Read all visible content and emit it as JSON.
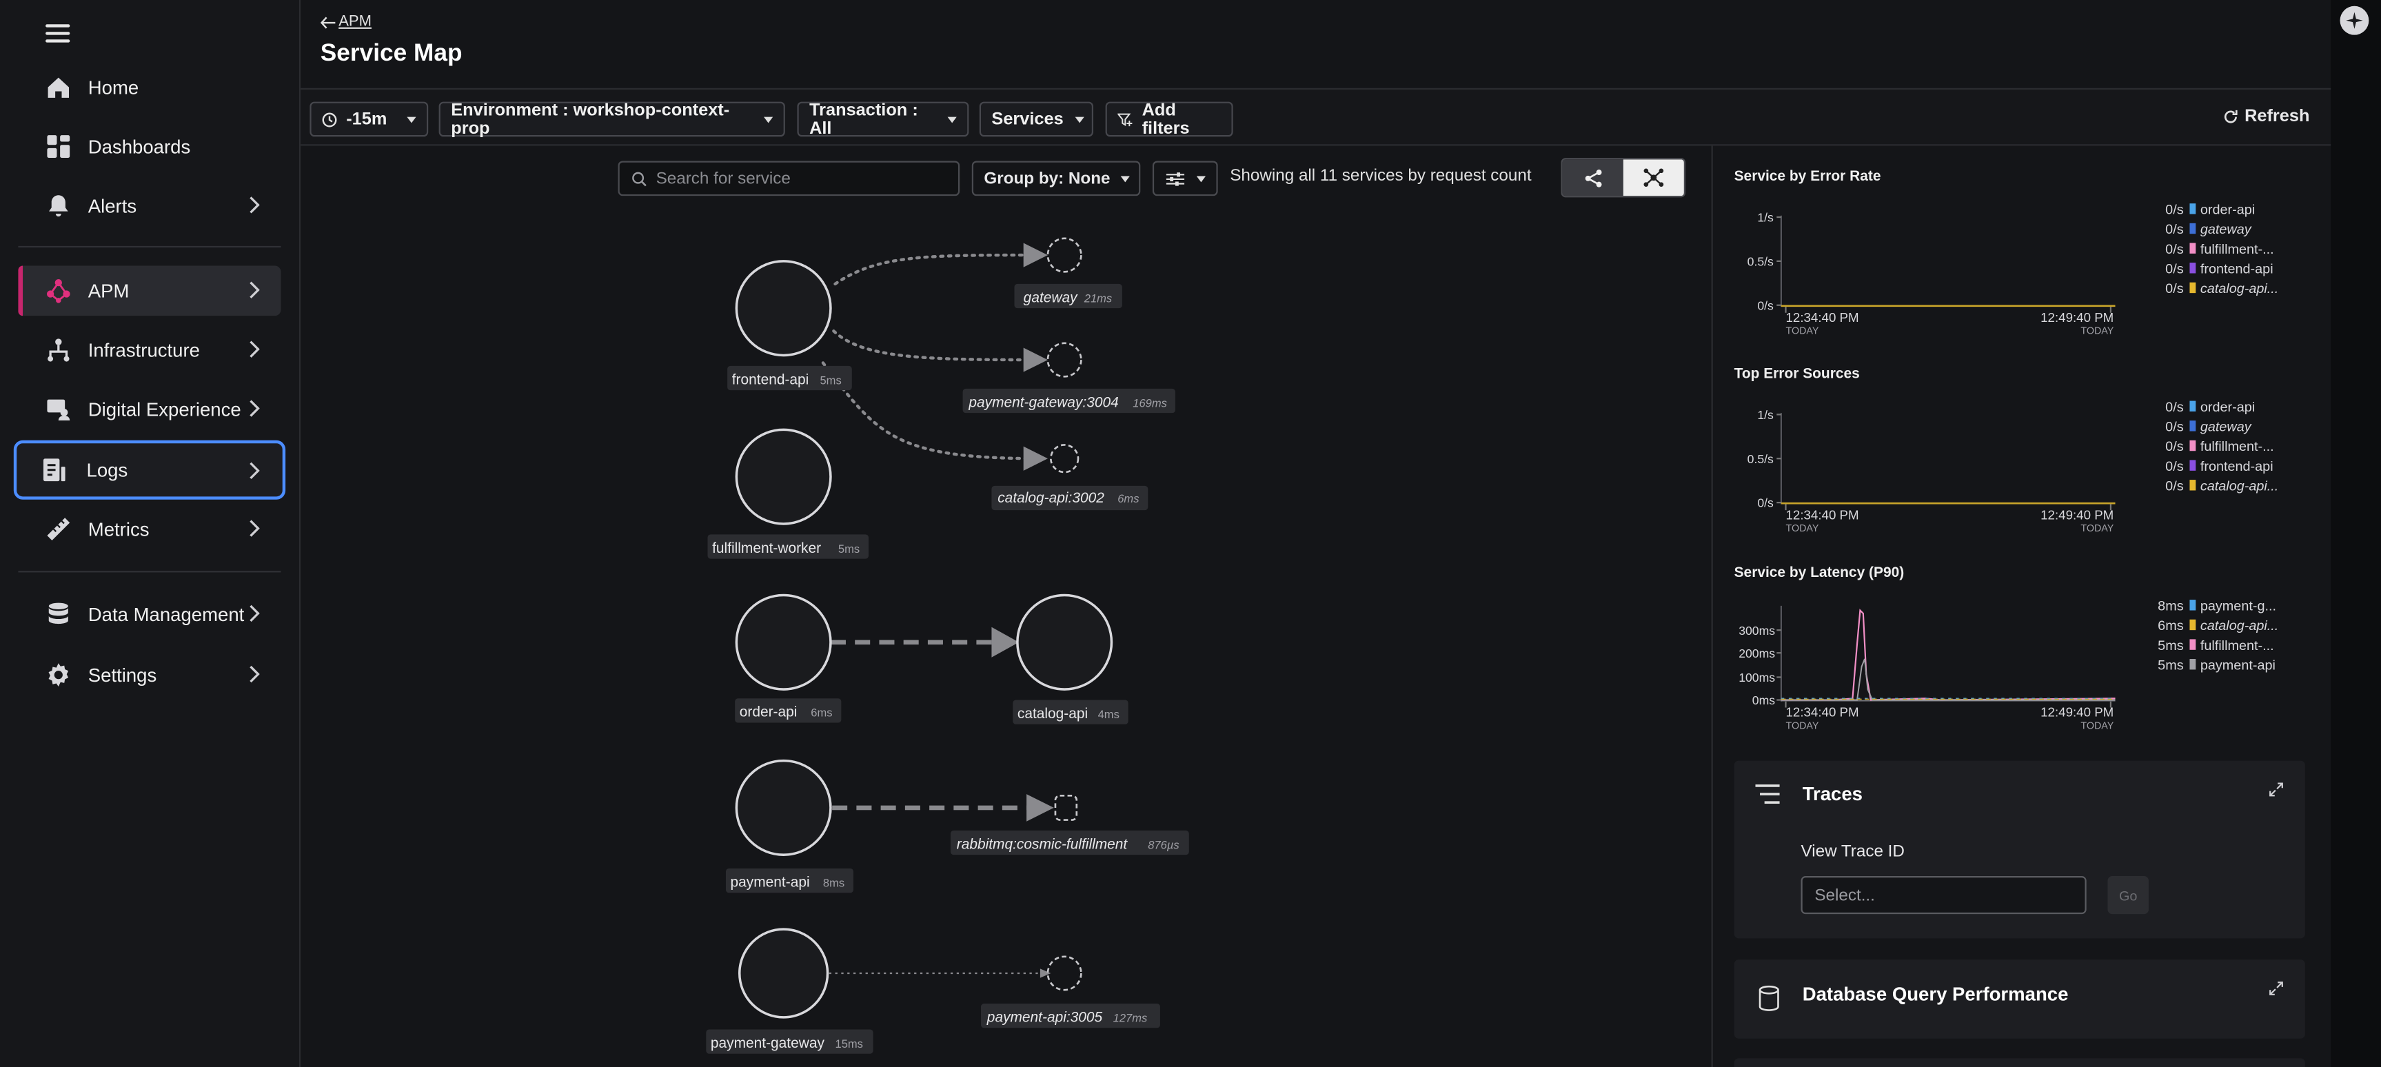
{
  "sidebar": {
    "items": [
      {
        "label": "Home",
        "icon": "home-icon"
      },
      {
        "label": "Dashboards",
        "icon": "dashboards-icon"
      },
      {
        "label": "Alerts",
        "icon": "bell-icon"
      },
      {
        "label": "APM",
        "icon": "apm-icon"
      },
      {
        "label": "Infrastructure",
        "icon": "infrastructure-icon"
      },
      {
        "label": "Digital Experience",
        "icon": "digital-experience-icon"
      },
      {
        "label": "Logs",
        "icon": "logs-icon"
      },
      {
        "label": "Metrics",
        "icon": "metrics-icon"
      },
      {
        "label": "Data Management",
        "icon": "database-icon"
      },
      {
        "label": "Settings",
        "icon": "gear-icon"
      }
    ],
    "active": "APM",
    "focused": "Logs",
    "accent": "#c7266d"
  },
  "header": {
    "back_label": "APM",
    "title": "Service Map"
  },
  "filters": {
    "time": "-15m",
    "environment": "Environment : workshop-context-prop",
    "transaction": "Transaction : All",
    "services": "Services",
    "add_filters": "Add filters",
    "refresh": "Refresh"
  },
  "toolbar": {
    "search_placeholder": "Search for service",
    "group_by": "Group by: None",
    "showing": "Showing all 11 services by request count"
  },
  "map": {
    "services": [
      {
        "name": "frontend-api",
        "latency": "5ms"
      },
      {
        "name": "fulfillment-worker",
        "latency": "5ms"
      },
      {
        "name": "order-api",
        "latency": "6ms"
      },
      {
        "name": "catalog-api",
        "latency": "4ms"
      },
      {
        "name": "payment-api",
        "latency": "8ms"
      },
      {
        "name": "payment-gateway",
        "latency": "15ms"
      }
    ],
    "external": [
      {
        "name": "gateway",
        "latency": "21ms"
      },
      {
        "name": "payment-gateway:3004",
        "latency": "169ms"
      },
      {
        "name": "catalog-api:3002",
        "latency": "6ms"
      },
      {
        "name": "rabbitmq:cosmic-fulfillment",
        "latency": "876µs"
      },
      {
        "name": "payment-api:3005",
        "latency": "127ms"
      }
    ]
  },
  "panels": {
    "error_rate": {
      "title": "Service by Error Rate",
      "yticks": [
        "1/s",
        "0.5/s",
        "0/s"
      ],
      "xticks": [
        {
          "time": "12:34:40 PM",
          "day": "TODAY"
        },
        {
          "time": "12:49:40 PM",
          "day": "TODAY"
        }
      ],
      "legend": [
        {
          "value": "0/s",
          "name": "order-api",
          "color": "#4aa3e8",
          "italic": false
        },
        {
          "value": "0/s",
          "name": "gateway",
          "color": "#3d6fd6",
          "italic": true
        },
        {
          "value": "0/s",
          "name": "fulfillment-...",
          "color": "#f28fc6",
          "italic": false
        },
        {
          "value": "0/s",
          "name": "frontend-api",
          "color": "#8a4fe0",
          "italic": false
        },
        {
          "value": "0/s",
          "name": "catalog-api...",
          "color": "#e6b82e",
          "italic": true
        }
      ]
    },
    "error_sources": {
      "title": "Top Error Sources",
      "yticks": [
        "1/s",
        "0.5/s",
        "0/s"
      ],
      "xticks": [
        {
          "time": "12:34:40 PM",
          "day": "TODAY"
        },
        {
          "time": "12:49:40 PM",
          "day": "TODAY"
        }
      ],
      "legend": [
        {
          "value": "0/s",
          "name": "order-api",
          "color": "#4aa3e8",
          "italic": false
        },
        {
          "value": "0/s",
          "name": "gateway",
          "color": "#3d6fd6",
          "italic": true
        },
        {
          "value": "0/s",
          "name": "fulfillment-...",
          "color": "#f28fc6",
          "italic": false
        },
        {
          "value": "0/s",
          "name": "frontend-api",
          "color": "#8a4fe0",
          "italic": false
        },
        {
          "value": "0/s",
          "name": "catalog-api...",
          "color": "#e6b82e",
          "italic": true
        }
      ]
    },
    "latency": {
      "title": "Service by Latency (P90)",
      "yticks": [
        "300ms",
        "200ms",
        "100ms",
        "0ms"
      ],
      "xticks": [
        {
          "time": "12:34:40 PM",
          "day": "TODAY"
        },
        {
          "time": "12:49:40 PM",
          "day": "TODAY"
        }
      ],
      "legend": [
        {
          "value": "8ms",
          "name": "payment-g...",
          "color": "#4aa3e8",
          "italic": false
        },
        {
          "value": "6ms",
          "name": "catalog-api...",
          "color": "#e6b82e",
          "italic": true
        },
        {
          "value": "5ms",
          "name": "fulfillment-...",
          "color": "#f28fc6",
          "italic": false
        },
        {
          "value": "5ms",
          "name": "payment-api",
          "color": "#a0a0a6",
          "italic": false
        }
      ]
    },
    "traces": {
      "title": "Traces",
      "view_trace_label": "View Trace ID",
      "input_placeholder": "Select...",
      "go_label": "Go"
    },
    "db": {
      "title": "Database Query Performance"
    }
  }
}
